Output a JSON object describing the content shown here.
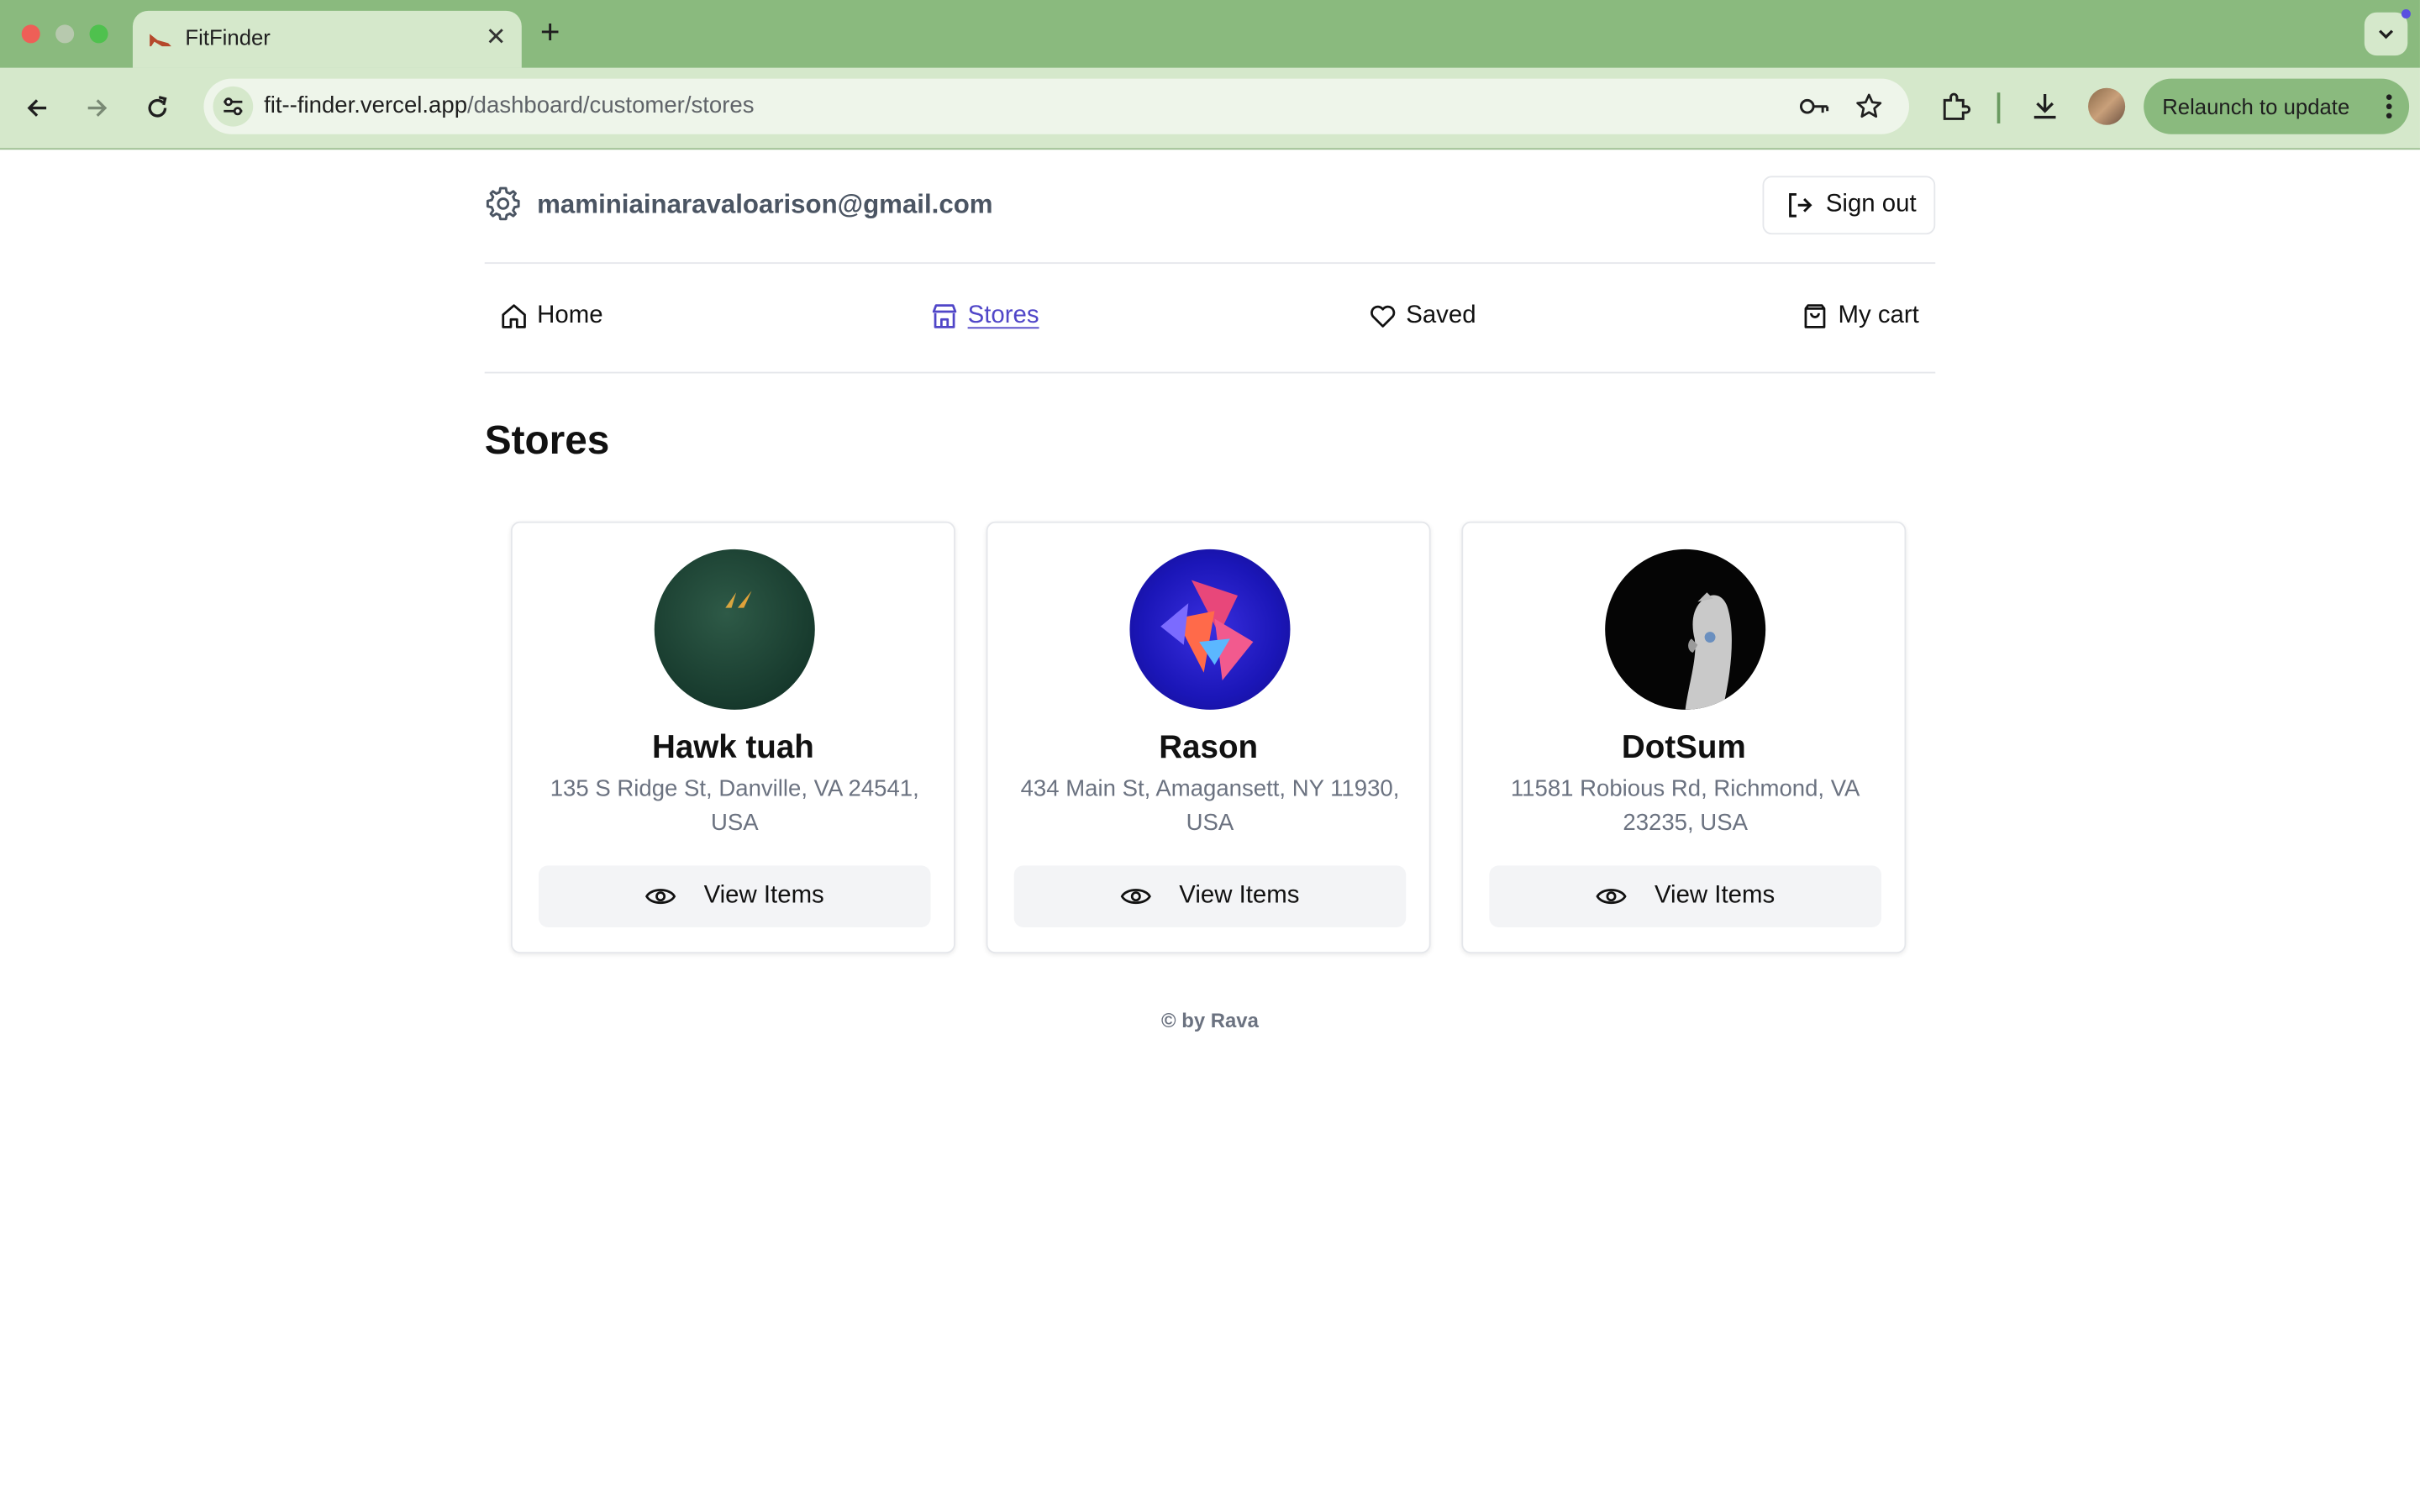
{
  "browser": {
    "tab_title": "FitFinder",
    "url_host": "fit--finder.vercel.app",
    "url_path": "/dashboard/customer/stores",
    "relaunch_label": "Relaunch to update"
  },
  "header": {
    "email": "maminiainaravaloarison@gmail.com",
    "signout_label": "Sign out"
  },
  "nav": {
    "home": "Home",
    "stores": "Stores",
    "saved": "Saved",
    "cart": "My cart"
  },
  "page": {
    "title": "Stores"
  },
  "stores": [
    {
      "name": "Hawk tuah",
      "address": "135 S Ridge St, Danville, VA 24541, USA",
      "button": "View Items"
    },
    {
      "name": "Rason",
      "address": "434 Main St, Amagansett, NY 11930, USA",
      "button": "View Items"
    },
    {
      "name": "DotSum",
      "address": "11581 Robious Rd, Richmond, VA 23235, USA",
      "button": "View Items"
    }
  ],
  "footer": {
    "text": "© by Rava"
  },
  "colors": {
    "accent": "#5046c8",
    "chrome": "#8aba7e",
    "chrome_light": "#d5e8cb"
  }
}
